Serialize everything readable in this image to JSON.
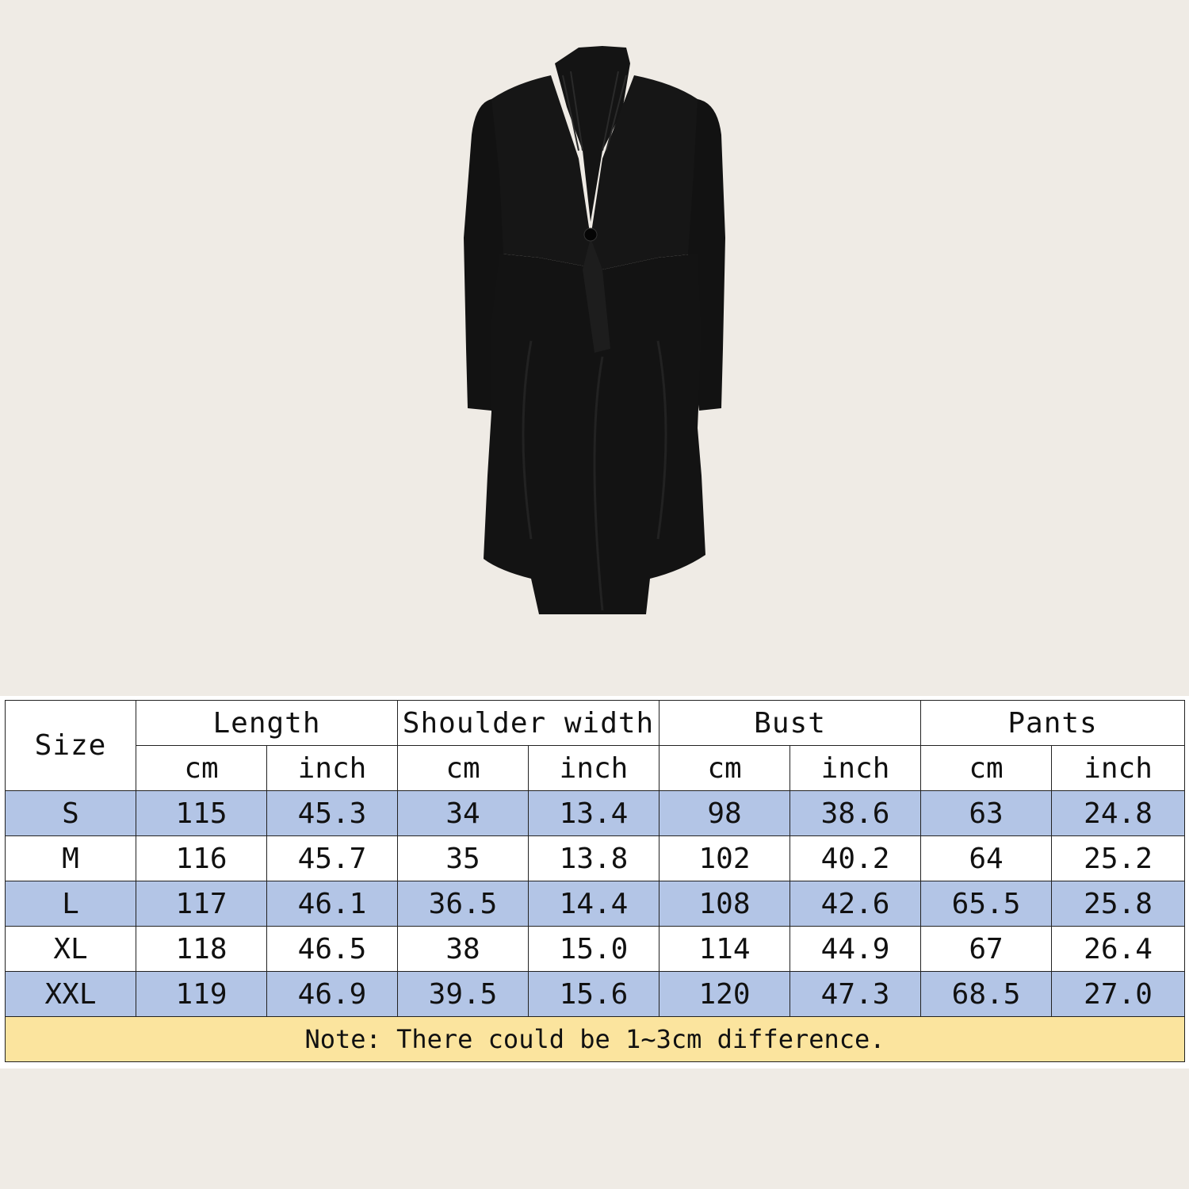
{
  "product": {
    "image": "black-coat-image"
  },
  "colors": {
    "background": "#efebe5",
    "row_highlight": "#b3c5e6",
    "note_background": "#fbe49e",
    "coat": "#141414"
  },
  "size_chart": {
    "size_header": "Size",
    "groups": [
      "Length",
      "Shoulder width",
      "Bust",
      "Pants"
    ],
    "units": [
      "cm",
      "inch",
      "cm",
      "inch",
      "cm",
      "inch",
      "cm",
      "inch"
    ],
    "rows": [
      {
        "size": "S",
        "values": [
          "115",
          "45.3",
          "34",
          "13.4",
          "98",
          "38.6",
          "63",
          "24.8"
        ]
      },
      {
        "size": "M",
        "values": [
          "116",
          "45.7",
          "35",
          "13.8",
          "102",
          "40.2",
          "64",
          "25.2"
        ]
      },
      {
        "size": "L",
        "values": [
          "117",
          "46.1",
          "36.5",
          "14.4",
          "108",
          "42.6",
          "65.5",
          "25.8"
        ]
      },
      {
        "size": "XL",
        "values": [
          "118",
          "46.5",
          "38",
          "15.0",
          "114",
          "44.9",
          "67",
          "26.4"
        ]
      },
      {
        "size": "XXL",
        "values": [
          "119",
          "46.9",
          "39.5",
          "15.6",
          "120",
          "47.3",
          "68.5",
          "27.0"
        ]
      }
    ],
    "note": "Note: There could be 1~3cm difference."
  }
}
